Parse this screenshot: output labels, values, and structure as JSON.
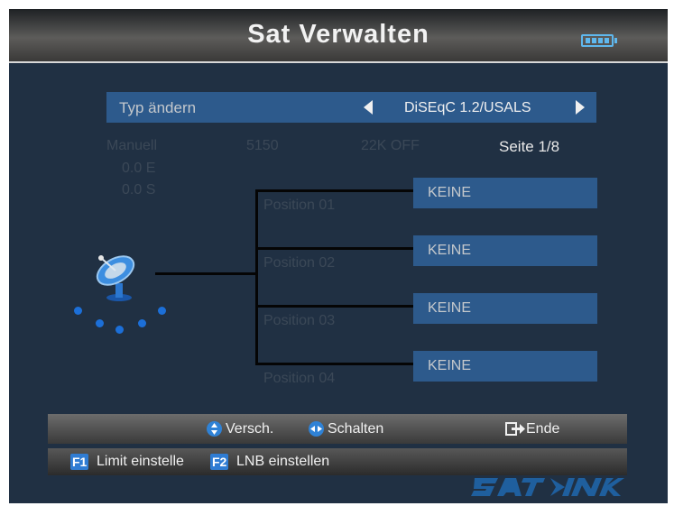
{
  "header": {
    "title": "Sat Verwalten",
    "battery_icon": "battery-icon"
  },
  "type_selector": {
    "label": "Typ ändern",
    "value": "DiSEqC 1.2/USALS",
    "left_icon": "arrow-left-icon",
    "right_icon": "arrow-right-icon"
  },
  "info": {
    "mode": "Manuell",
    "frequency": "5150",
    "tone": "22K OFF",
    "longitude": "0.0 E",
    "latitude": "0.0 S",
    "page": "Seite 1/8"
  },
  "positions": [
    {
      "label": "Position 01",
      "satellite": "KEINE"
    },
    {
      "label": "Position 02",
      "satellite": "KEINE"
    },
    {
      "label": "Position 03",
      "satellite": "KEINE"
    },
    {
      "label": "Position 04",
      "satellite": "KEINE"
    }
  ],
  "hints": {
    "move": "Versch.",
    "switch": "Schalten",
    "exit": "Ende",
    "move_icon": "up-down-icon",
    "switch_icon": "left-right-icon",
    "exit_icon": "exit-icon"
  },
  "function_keys": [
    {
      "key": "F1",
      "label": "Limit einstelle"
    },
    {
      "key": "F2",
      "label": "LNB einstellen"
    }
  ],
  "colors": {
    "background": "#203043",
    "highlight": "#2d5a8c",
    "accent": "#2f82d6"
  }
}
